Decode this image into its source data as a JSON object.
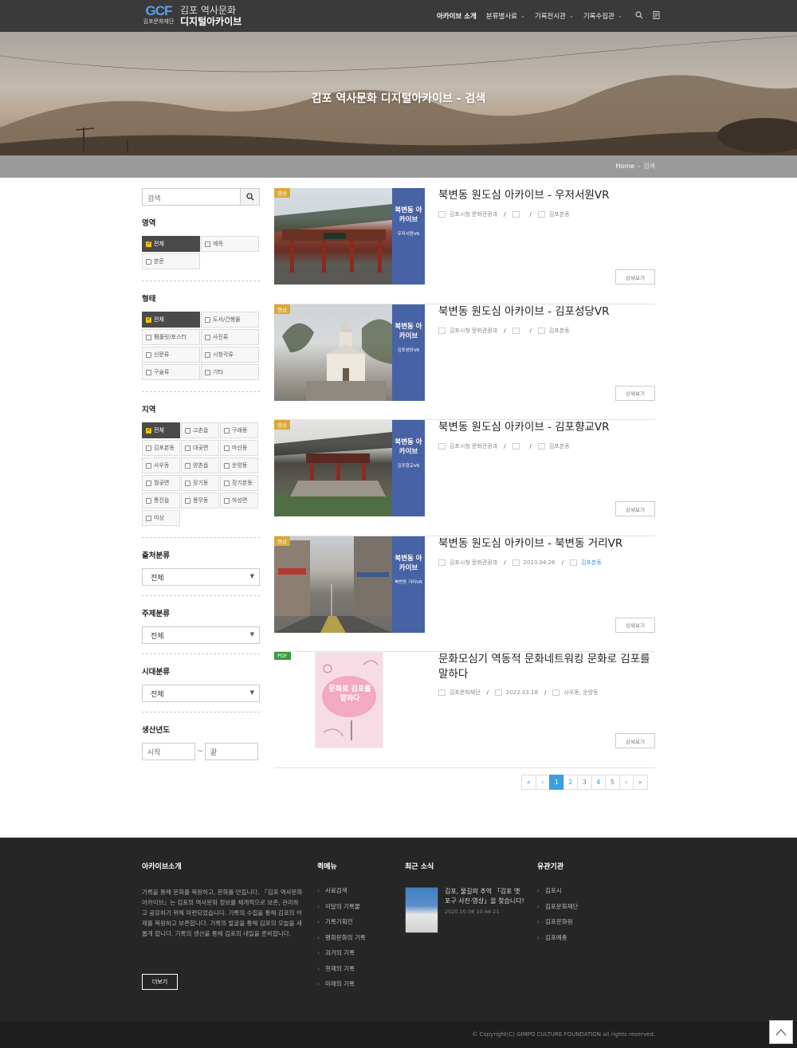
{
  "header": {
    "logo_symbol": "GCF",
    "logo_org": "김포문화재단",
    "logo_line1": "김포 역사문화",
    "logo_line2": "디지털아카이브",
    "nav": [
      {
        "label": "아카이브 소개",
        "active": true,
        "dropdown": false
      },
      {
        "label": "분류별사료",
        "active": false,
        "dropdown": true
      },
      {
        "label": "기록전시관",
        "active": false,
        "dropdown": true
      },
      {
        "label": "기록수집관",
        "active": false,
        "dropdown": true
      }
    ]
  },
  "hero": {
    "title": "김포 역사문화 디지털아카이브 - 검색"
  },
  "breadcrumb": {
    "home": "Home",
    "current": "검색"
  },
  "sidebar": {
    "search_placeholder": "검색",
    "area": {
      "title": "영역",
      "options": [
        "전체",
        "제목",
        "본문"
      ],
      "selected": "전체"
    },
    "form": {
      "title": "형태",
      "options": [
        "전체",
        "도서/간행물",
        "팸플릿/포스터",
        "사진류",
        "신문류",
        "시청각류",
        "구술류",
        "기타"
      ],
      "selected": "전체"
    },
    "region": {
      "title": "지역",
      "options": [
        "전체",
        "고촌읍",
        "구래동",
        "김포본동",
        "대곶면",
        "마산동",
        "사우동",
        "양촌읍",
        "운양동",
        "월곶면",
        "장기동",
        "장기본동",
        "통진읍",
        "풍무동",
        "하성면",
        "미상"
      ],
      "selected": "전체"
    },
    "source": {
      "title": "출처분류",
      "value": "전체"
    },
    "subject": {
      "title": "주제분류",
      "value": "전체"
    },
    "era": {
      "title": "시대분류",
      "value": "전체"
    },
    "year": {
      "title": "생산년도",
      "start_placeholder": "시작",
      "end_placeholder": "끝",
      "dash": "~"
    }
  },
  "results": [
    {
      "badge": "영상",
      "title": "북변동 원도심 아카이브 - 우저서원VR",
      "org": "김포시청 문화관광과",
      "date": "",
      "place": "김포본동",
      "place_hl": false,
      "panel_title": "북변동 아카이브",
      "panel_sub": "우저서원VR",
      "more": "상세보기"
    },
    {
      "badge": "영상",
      "title": "북변동 원도심 아카이브 - 김포성당VR",
      "org": "김포시청 문화관광과",
      "date": "",
      "place": "김포본동",
      "place_hl": false,
      "panel_title": "북변동 아카이브",
      "panel_sub": "김포성당VR",
      "more": "상세보기"
    },
    {
      "badge": "영상",
      "title": "북변동 원도심 아카이브 - 김포향교VR",
      "org": "김포시청 문화관광과",
      "date": "",
      "place": "김포본동",
      "place_hl": false,
      "panel_title": "북변동 아카이브",
      "panel_sub": "김포향교VR",
      "more": "상세보기"
    },
    {
      "badge": "영상",
      "title": "북변동 원도심 아카이브 - 북변동 거리VR",
      "org": "김포시청 문화관광과",
      "date": "2023.04.26",
      "place": "김포본동",
      "place_hl": true,
      "panel_title": "북변동 아카이브",
      "panel_sub": "북변동 거리VR",
      "more": "상세보기"
    },
    {
      "badge": "PDF",
      "title": "문화모심기 역동적 문화네트워킹 문화로 김포를 말하다",
      "org": "김포문화재단",
      "date": "2022.03.18",
      "place": "사우동, 운양동",
      "place_hl": false,
      "poster_title": "문화로 김포를 말하다",
      "more": "상세보기"
    }
  ],
  "pagination": {
    "first": "«",
    "prev": "‹",
    "pages": [
      "1",
      "2",
      "3",
      "4",
      "5"
    ],
    "current": "1",
    "next": "›",
    "last": "»"
  },
  "footer": {
    "about": {
      "title": "아카이브소개",
      "text": "기록을 통해 문화를 복원하고, 문화를 만듭니다. 『김포 역사문화 아카이브』는 김포의 역사문화 정보를 체계적으로 보존, 관리하고 공유하기 위해 마련되었습니다. 기록의 수집을 통해 김포의 어제를 복원하고 보존합니다. 기록의 발굴을 통해 김포의 오늘을 새롭게 합니다. 기록의 생산을 통해 김포의 내일을 준비합니다.",
      "button": "더보기"
    },
    "quick": {
      "title": "퀵메뉴",
      "items": [
        "사료검색",
        "이달의 기록물",
        "기록기획전",
        "평화문화의 기록",
        "과거의 기록",
        "현재의 기록",
        "미래의 기록"
      ]
    },
    "news": {
      "title": "최근 소식",
      "headline": "김포, 물길의 추억 「김포 옛 포구 사진·영상」을 찾습니다!",
      "date": "2020.10.08 10:44:21"
    },
    "related": {
      "title": "유관기관",
      "items": [
        "김포시",
        "김포문화재단",
        "김포문화원",
        "김포예총"
      ]
    },
    "copyright": "© Copyright(C) GIMPO CULTURE FOUNDATION all rights reserved."
  },
  "colors": {
    "accent": "#3b9fe0",
    "badge_video": "#d8a83a",
    "badge_pdf": "#3c9a3c",
    "panel": "#4763a5",
    "checkbox_on": "#f5c400"
  }
}
